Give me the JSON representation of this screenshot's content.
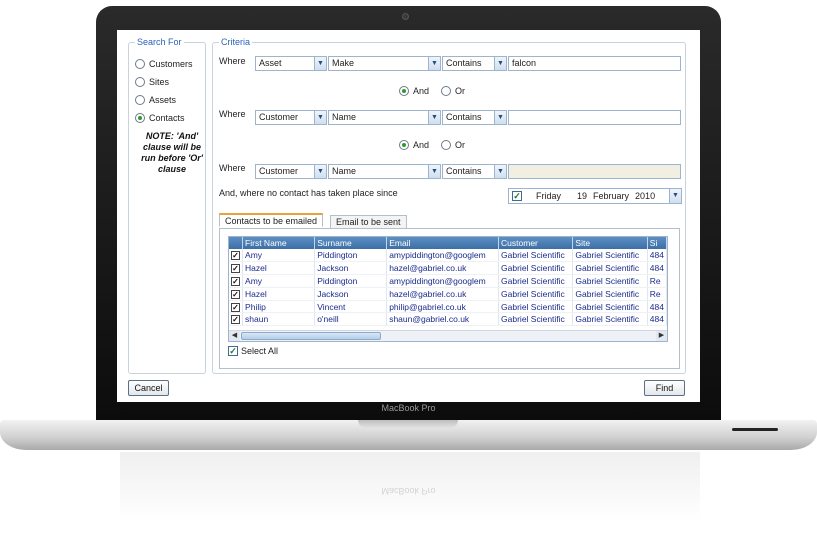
{
  "device": {
    "brand": "MacBook Pro"
  },
  "search_for": {
    "legend": "Search For",
    "options": [
      {
        "label": "Customers",
        "selected": false
      },
      {
        "label": "Sites",
        "selected": false
      },
      {
        "label": "Assets",
        "selected": false
      },
      {
        "label": "Contacts",
        "selected": true
      }
    ],
    "note": "NOTE: 'And' clause will be run before 'Or' clause"
  },
  "criteria": {
    "legend": "Criteria",
    "where_label": "Where",
    "rows": [
      {
        "entity": "Asset",
        "field": "Make",
        "operator": "Contains",
        "value": "falcon"
      },
      {
        "entity": "Customer",
        "field": "Name",
        "operator": "Contains",
        "value": ""
      },
      {
        "entity": "Customer",
        "field": "Name",
        "operator": "Contains",
        "value": ""
      }
    ],
    "connectors": [
      {
        "and_label": "And",
        "or_label": "Or",
        "selected": "And"
      },
      {
        "and_label": "And",
        "or_label": "Or",
        "selected": "And"
      }
    ],
    "no_contact_label": "And, where no contact has taken place since",
    "date": {
      "day": "Friday",
      "date": "19",
      "month": "February",
      "year": "2010",
      "checked": true
    }
  },
  "tabs": [
    {
      "label": "Contacts to be emailed",
      "active": true
    },
    {
      "label": "Email to be sent",
      "active": false
    }
  ],
  "grid": {
    "columns": [
      "First Name",
      "Surname",
      "Email",
      "Customer",
      "Site",
      "Si"
    ],
    "rows": [
      {
        "checked": true,
        "cells": [
          "Amy",
          "Piddington",
          "amypiddington@googlem",
          "Gabriel Scientific",
          "Gabriel Scientific",
          "484"
        ]
      },
      {
        "checked": true,
        "cells": [
          "Hazel",
          "Jackson",
          "hazel@gabriel.co.uk",
          "Gabriel Scientific",
          "Gabriel Scientific",
          "484"
        ]
      },
      {
        "checked": true,
        "cells": [
          "Amy",
          "Piddington",
          "amypiddington@googlem",
          "Gabriel Scientific",
          "Gabriel Scientific",
          "Re"
        ]
      },
      {
        "checked": true,
        "cells": [
          "Hazel",
          "Jackson",
          "hazel@gabriel.co.uk",
          "Gabriel Scientific",
          "Gabriel Scientific",
          "Re"
        ]
      },
      {
        "checked": true,
        "cells": [
          "Philip",
          "Vincent",
          "philip@gabriel.co.uk",
          "Gabriel Scientific",
          "Gabriel Scientific",
          "484"
        ]
      },
      {
        "checked": true,
        "cells": [
          "shaun",
          "o'neill",
          "shaun@gabriel.co.uk",
          "Gabriel Scientific",
          "Gabriel Scientific",
          "484"
        ]
      }
    ]
  },
  "select_all_label": "Select All",
  "buttons": {
    "cancel": "Cancel",
    "find": "Find"
  },
  "colors": {
    "accent": "#2b63b8",
    "header": "#4a7db5",
    "radio_on": "#2f9a2f"
  }
}
